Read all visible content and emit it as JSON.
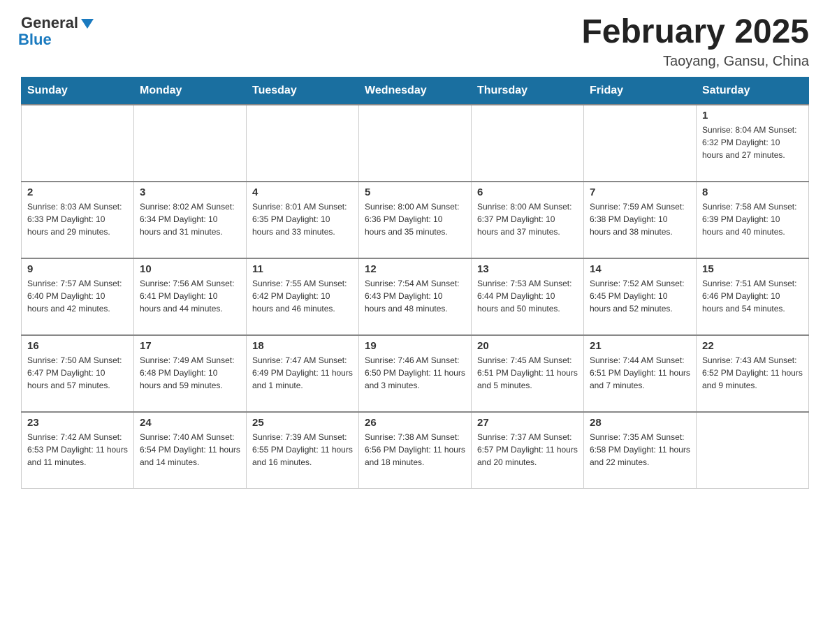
{
  "header": {
    "logo_general": "General",
    "logo_blue": "Blue",
    "title": "February 2025",
    "subtitle": "Taoyang, Gansu, China"
  },
  "days_of_week": [
    "Sunday",
    "Monday",
    "Tuesday",
    "Wednesday",
    "Thursday",
    "Friday",
    "Saturday"
  ],
  "weeks": [
    [
      {
        "day": "",
        "info": ""
      },
      {
        "day": "",
        "info": ""
      },
      {
        "day": "",
        "info": ""
      },
      {
        "day": "",
        "info": ""
      },
      {
        "day": "",
        "info": ""
      },
      {
        "day": "",
        "info": ""
      },
      {
        "day": "1",
        "info": "Sunrise: 8:04 AM\nSunset: 6:32 PM\nDaylight: 10 hours and 27 minutes."
      }
    ],
    [
      {
        "day": "2",
        "info": "Sunrise: 8:03 AM\nSunset: 6:33 PM\nDaylight: 10 hours and 29 minutes."
      },
      {
        "day": "3",
        "info": "Sunrise: 8:02 AM\nSunset: 6:34 PM\nDaylight: 10 hours and 31 minutes."
      },
      {
        "day": "4",
        "info": "Sunrise: 8:01 AM\nSunset: 6:35 PM\nDaylight: 10 hours and 33 minutes."
      },
      {
        "day": "5",
        "info": "Sunrise: 8:00 AM\nSunset: 6:36 PM\nDaylight: 10 hours and 35 minutes."
      },
      {
        "day": "6",
        "info": "Sunrise: 8:00 AM\nSunset: 6:37 PM\nDaylight: 10 hours and 37 minutes."
      },
      {
        "day": "7",
        "info": "Sunrise: 7:59 AM\nSunset: 6:38 PM\nDaylight: 10 hours and 38 minutes."
      },
      {
        "day": "8",
        "info": "Sunrise: 7:58 AM\nSunset: 6:39 PM\nDaylight: 10 hours and 40 minutes."
      }
    ],
    [
      {
        "day": "9",
        "info": "Sunrise: 7:57 AM\nSunset: 6:40 PM\nDaylight: 10 hours and 42 minutes."
      },
      {
        "day": "10",
        "info": "Sunrise: 7:56 AM\nSunset: 6:41 PM\nDaylight: 10 hours and 44 minutes."
      },
      {
        "day": "11",
        "info": "Sunrise: 7:55 AM\nSunset: 6:42 PM\nDaylight: 10 hours and 46 minutes."
      },
      {
        "day": "12",
        "info": "Sunrise: 7:54 AM\nSunset: 6:43 PM\nDaylight: 10 hours and 48 minutes."
      },
      {
        "day": "13",
        "info": "Sunrise: 7:53 AM\nSunset: 6:44 PM\nDaylight: 10 hours and 50 minutes."
      },
      {
        "day": "14",
        "info": "Sunrise: 7:52 AM\nSunset: 6:45 PM\nDaylight: 10 hours and 52 minutes."
      },
      {
        "day": "15",
        "info": "Sunrise: 7:51 AM\nSunset: 6:46 PM\nDaylight: 10 hours and 54 minutes."
      }
    ],
    [
      {
        "day": "16",
        "info": "Sunrise: 7:50 AM\nSunset: 6:47 PM\nDaylight: 10 hours and 57 minutes."
      },
      {
        "day": "17",
        "info": "Sunrise: 7:49 AM\nSunset: 6:48 PM\nDaylight: 10 hours and 59 minutes."
      },
      {
        "day": "18",
        "info": "Sunrise: 7:47 AM\nSunset: 6:49 PM\nDaylight: 11 hours and 1 minute."
      },
      {
        "day": "19",
        "info": "Sunrise: 7:46 AM\nSunset: 6:50 PM\nDaylight: 11 hours and 3 minutes."
      },
      {
        "day": "20",
        "info": "Sunrise: 7:45 AM\nSunset: 6:51 PM\nDaylight: 11 hours and 5 minutes."
      },
      {
        "day": "21",
        "info": "Sunrise: 7:44 AM\nSunset: 6:51 PM\nDaylight: 11 hours and 7 minutes."
      },
      {
        "day": "22",
        "info": "Sunrise: 7:43 AM\nSunset: 6:52 PM\nDaylight: 11 hours and 9 minutes."
      }
    ],
    [
      {
        "day": "23",
        "info": "Sunrise: 7:42 AM\nSunset: 6:53 PM\nDaylight: 11 hours and 11 minutes."
      },
      {
        "day": "24",
        "info": "Sunrise: 7:40 AM\nSunset: 6:54 PM\nDaylight: 11 hours and 14 minutes."
      },
      {
        "day": "25",
        "info": "Sunrise: 7:39 AM\nSunset: 6:55 PM\nDaylight: 11 hours and 16 minutes."
      },
      {
        "day": "26",
        "info": "Sunrise: 7:38 AM\nSunset: 6:56 PM\nDaylight: 11 hours and 18 minutes."
      },
      {
        "day": "27",
        "info": "Sunrise: 7:37 AM\nSunset: 6:57 PM\nDaylight: 11 hours and 20 minutes."
      },
      {
        "day": "28",
        "info": "Sunrise: 7:35 AM\nSunset: 6:58 PM\nDaylight: 11 hours and 22 minutes."
      },
      {
        "day": "",
        "info": ""
      }
    ]
  ]
}
